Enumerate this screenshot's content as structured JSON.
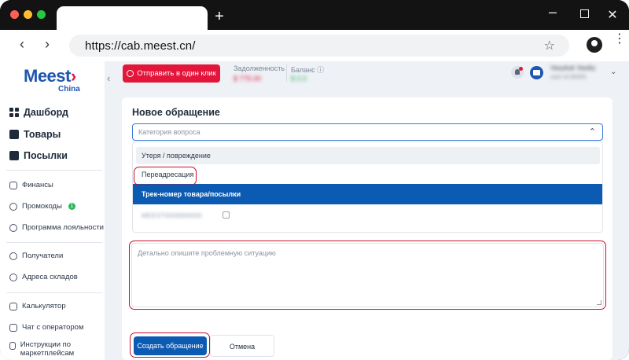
{
  "browser": {
    "url": "https://cab.meest.cn/"
  },
  "logo": {
    "main": "Meest",
    "sub": "China"
  },
  "sidebar": {
    "main_items": [
      {
        "label": "Дашборд",
        "icon": "dashboard-icon"
      },
      {
        "label": "Товары",
        "icon": "box-icon"
      },
      {
        "label": "Посылки",
        "icon": "parcel-icon"
      }
    ],
    "items": [
      {
        "label": "Финансы",
        "icon": "wallet-icon"
      },
      {
        "label": "Промокоды",
        "icon": "percent-icon",
        "badge": "1"
      },
      {
        "label": "Программа лояльности",
        "icon": "loyalty-icon"
      },
      {
        "label": "Получатели",
        "icon": "recipients-icon"
      },
      {
        "label": "Адреса складов",
        "icon": "location-icon"
      },
      {
        "label": "Калькулятор",
        "icon": "calculator-icon"
      },
      {
        "label": "Чат с оператором",
        "icon": "chat-icon"
      },
      {
        "label": "Инструкции по маркетплейсам",
        "icon": "instructions-icon"
      }
    ]
  },
  "header": {
    "send_button": "Отправить в один клик",
    "debt_label": "Задолженность",
    "debt_value": "$ 775.00",
    "balance_label": "Баланс",
    "balance_value": "$ 0.0"
  },
  "user": {
    "name": "Vasyliuk Vasiliy",
    "sub": "user id 00000"
  },
  "form": {
    "title": "Новое обращение",
    "category_placeholder": "Категория вопроса",
    "options": [
      "Утеря / повреждение",
      "Переадресация",
      "Трек-номер товара/посылки"
    ],
    "hidden_row": "MEEST0000000000",
    "description_placeholder": "Детально опишите проблемную ситуацию",
    "submit_label": "Создать обращение",
    "cancel_label": "Отмена"
  },
  "colors": {
    "brand_blue": "#0b5bb3",
    "brand_red": "#e3153b",
    "highlight_red": "#c8102e"
  }
}
